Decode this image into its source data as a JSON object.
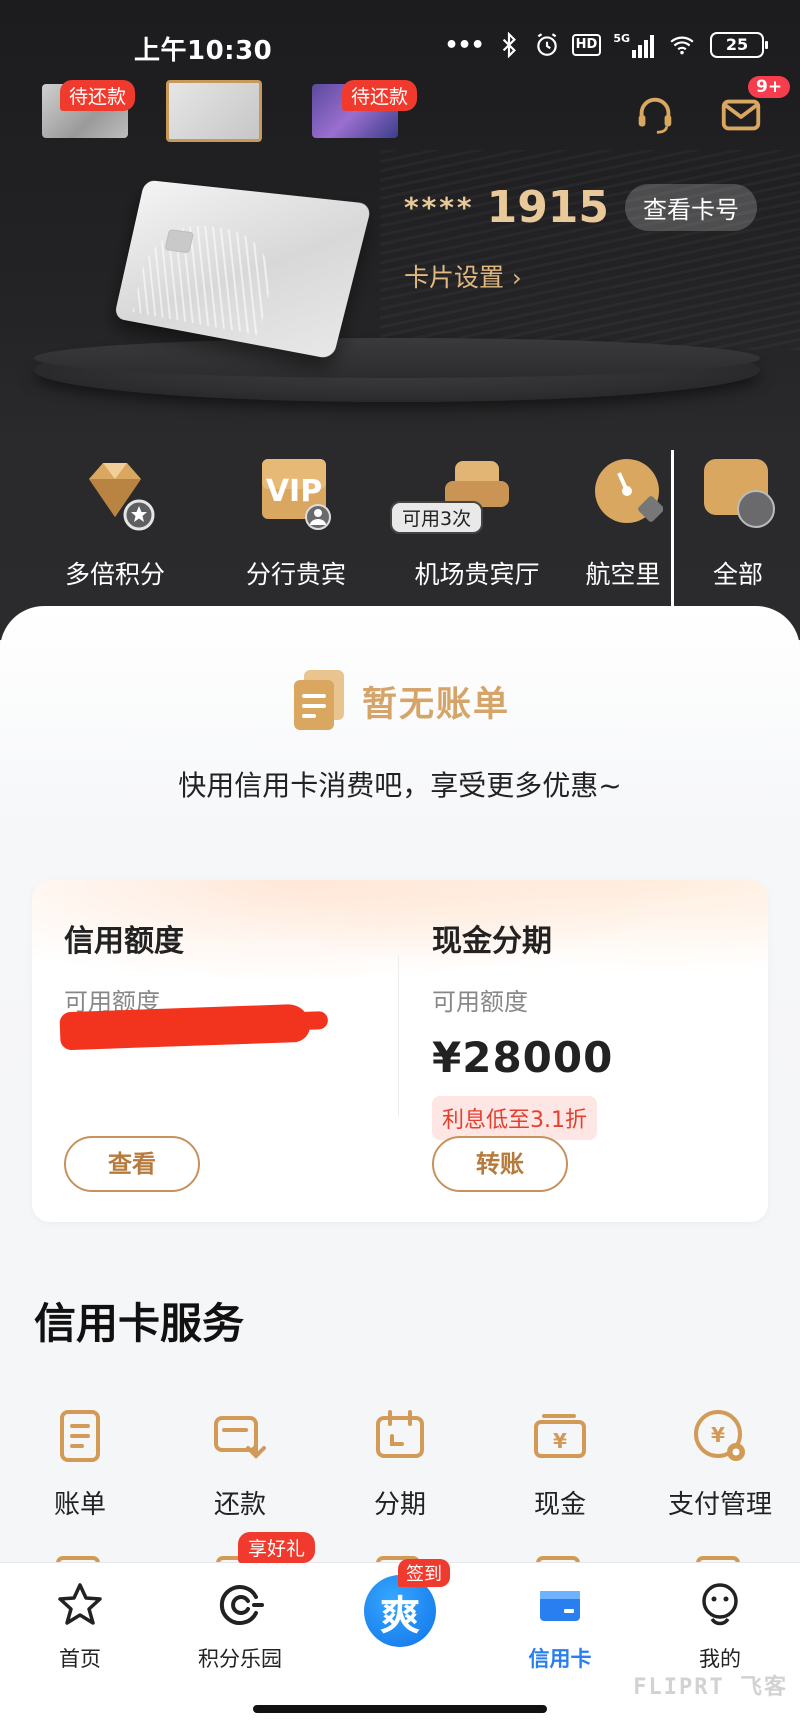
{
  "status_bar": {
    "time": "上午10:30",
    "network": "5G",
    "battery": "25"
  },
  "card_switcher": {
    "due_tags": [
      "待还款",
      "待还款"
    ],
    "message_badge": "9+"
  },
  "card": {
    "mask": "****",
    "last4": "1915",
    "view_number_label": "查看卡号",
    "settings_label": "卡片设置"
  },
  "perks": [
    {
      "label": "多倍积分",
      "icon": "diamond-icon"
    },
    {
      "label": "分行贵宾",
      "icon": "vip-icon"
    },
    {
      "label": "机场贵宾厅",
      "icon": "sofa-icon",
      "tag": "可用3次"
    },
    {
      "label": "航空里",
      "icon": "gauge-icon"
    },
    {
      "label": "全部",
      "icon": "grid-icon"
    }
  ],
  "bill": {
    "title": "暂无账单",
    "subtitle": "快用信用卡消费吧，享受更多优惠~"
  },
  "limits": {
    "credit": {
      "title": "信用额度",
      "sub": "可用额度",
      "button": "查看"
    },
    "cash": {
      "title": "现金分期",
      "sub": "可用额度",
      "amount": "¥28000",
      "tag": "利息低至3.1折",
      "button": "转账"
    }
  },
  "services": {
    "title": "信用卡服务",
    "row1": [
      {
        "label": "账单",
        "icon": "bill-icon"
      },
      {
        "label": "还款",
        "icon": "repay-icon"
      },
      {
        "label": "分期",
        "icon": "calendar-icon"
      },
      {
        "label": "现金",
        "icon": "cash-icon"
      },
      {
        "label": "支付管理",
        "icon": "payment-settings-icon"
      }
    ],
    "gift_tag": "享好礼"
  },
  "bottom_nav": {
    "items": [
      {
        "label": "首页",
        "icon": "star-icon"
      },
      {
        "label": "积分乐园",
        "icon": "points-icon"
      },
      {
        "label": "",
        "icon": "checkin-icon"
      },
      {
        "label": "信用卡",
        "icon": "credit-card-icon"
      },
      {
        "label": "我的",
        "icon": "profile-icon"
      }
    ],
    "checkin_tag": "签到"
  },
  "watermark": "FLIPRT 飞客",
  "colors": {
    "gold": "#d4a468",
    "red": "#f03a2e",
    "active_blue": "#2a7ff0"
  }
}
